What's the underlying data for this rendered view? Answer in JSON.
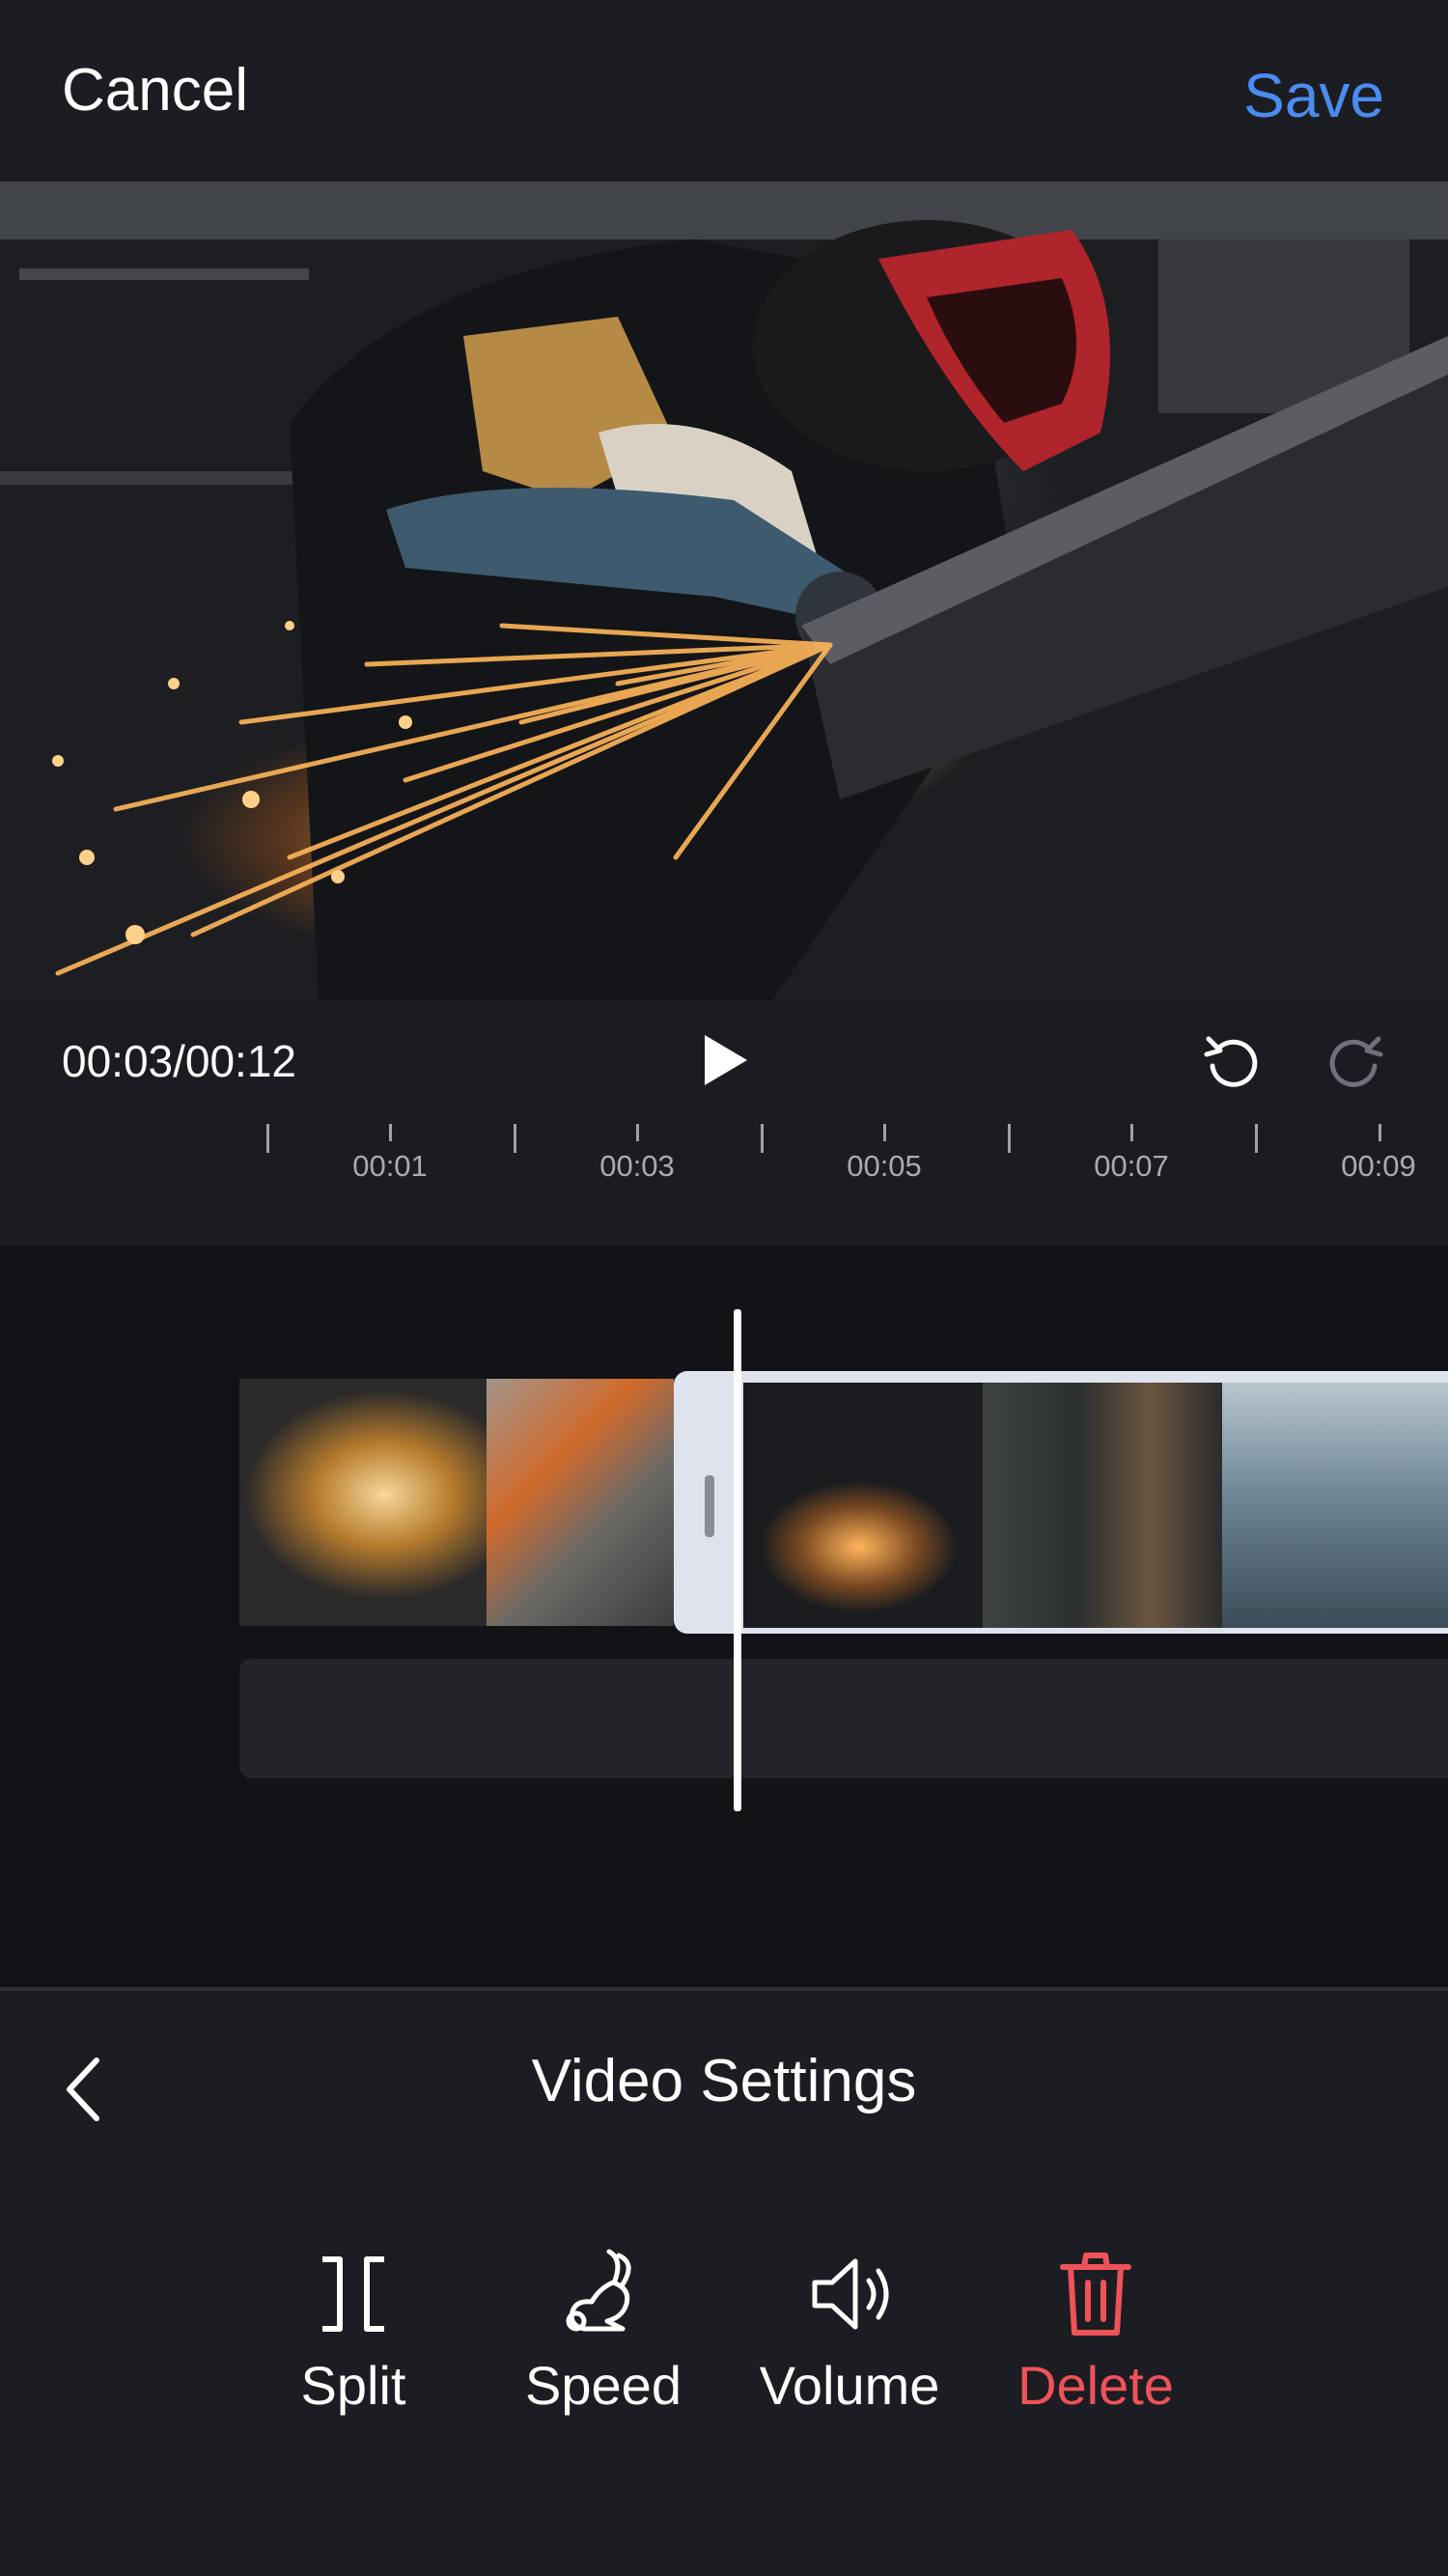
{
  "header": {
    "cancel_label": "Cancel",
    "save_label": "Save"
  },
  "colors": {
    "accent": "#4a8cf0",
    "danger": "#ee5359",
    "background": "#1c1d22",
    "timeline_bg": "#121316"
  },
  "player": {
    "current_time": "00:03",
    "duration": "00:12",
    "time_display": "00:03/00:12",
    "play_icon": "play-icon",
    "undo_icon": "undo-icon",
    "redo_icon": "redo-icon"
  },
  "ruler": {
    "labels": [
      "00:01",
      "00:03",
      "00:05",
      "00:07",
      "00:09"
    ]
  },
  "panel": {
    "title": "Video Settings",
    "back_icon": "chevron-left-icon",
    "tools": [
      {
        "label": "Split",
        "icon": "split-icon"
      },
      {
        "label": "Speed",
        "icon": "rabbit-icon"
      },
      {
        "label": "Volume",
        "icon": "speaker-icon"
      },
      {
        "label": "Delete",
        "icon": "trash-icon"
      }
    ]
  }
}
